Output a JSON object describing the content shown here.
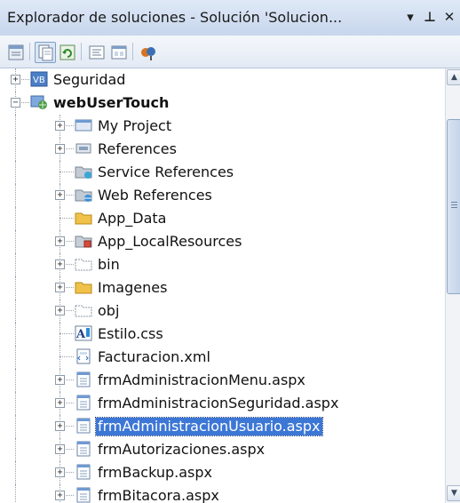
{
  "window": {
    "title": "Explorador de soluciones - Solución 'Solucion...",
    "dropdown_glyph": "▾",
    "pin_glyph": "ᛰ",
    "close_glyph": "✕"
  },
  "toolbar": {
    "buttons": [
      {
        "name": "properties-icon"
      },
      {
        "name": "show-all-files-icon"
      },
      {
        "name": "refresh-icon"
      },
      {
        "name": "view-code-icon"
      },
      {
        "name": "view-designer-icon"
      },
      {
        "name": "class-diagram-icon"
      }
    ]
  },
  "tree": {
    "items": [
      {
        "label": "Seguridad",
        "icon": "vb-project-icon",
        "level": 1,
        "expander": "+"
      },
      {
        "label": "webUserTouch",
        "icon": "web-project-icon",
        "level": 1,
        "expander": "−",
        "bold": true
      },
      {
        "label": "My Project",
        "icon": "my-project-icon",
        "level": 2,
        "expander": "+"
      },
      {
        "label": "References",
        "icon": "references-icon",
        "level": 2,
        "expander": "+"
      },
      {
        "label": "Service References",
        "icon": "service-references-icon",
        "level": 2,
        "expander": ""
      },
      {
        "label": "Web References",
        "icon": "web-references-icon",
        "level": 2,
        "expander": "+"
      },
      {
        "label": "App_Data",
        "icon": "folder-icon",
        "level": 2,
        "expander": ""
      },
      {
        "label": "App_LocalResources",
        "icon": "resources-folder-icon",
        "level": 2,
        "expander": "+"
      },
      {
        "label": "bin",
        "icon": "excluded-folder-icon",
        "level": 2,
        "expander": "+"
      },
      {
        "label": "Imagenes",
        "icon": "folder-icon",
        "level": 2,
        "expander": "+"
      },
      {
        "label": "obj",
        "icon": "excluded-folder-icon",
        "level": 2,
        "expander": "+"
      },
      {
        "label": "Estilo.css",
        "icon": "css-file-icon",
        "level": 2,
        "expander": ""
      },
      {
        "label": "Facturacion.xml",
        "icon": "xml-file-icon",
        "level": 2,
        "expander": ""
      },
      {
        "label": "frmAdministracionMenu.aspx",
        "icon": "aspx-file-icon",
        "level": 2,
        "expander": "+"
      },
      {
        "label": "frmAdministracionSeguridad.aspx",
        "icon": "aspx-file-icon",
        "level": 2,
        "expander": "+"
      },
      {
        "label": "frmAdministracionUsuario.aspx",
        "icon": "aspx-file-icon",
        "level": 2,
        "expander": "+",
        "selected": true
      },
      {
        "label": "frmAutorizaciones.aspx",
        "icon": "aspx-file-icon",
        "level": 2,
        "expander": "+"
      },
      {
        "label": "frmBackup.aspx",
        "icon": "aspx-file-icon",
        "level": 2,
        "expander": "+"
      },
      {
        "label": "frmBitacora.aspx",
        "icon": "aspx-file-icon",
        "level": 2,
        "expander": "+"
      }
    ]
  },
  "scrollbar": {
    "up_glyph": "▲",
    "down_glyph": "▼"
  },
  "colors": {
    "selection": "#3d77d6",
    "titlebar": "#c7d6ec",
    "folder": "#f0c24a"
  }
}
